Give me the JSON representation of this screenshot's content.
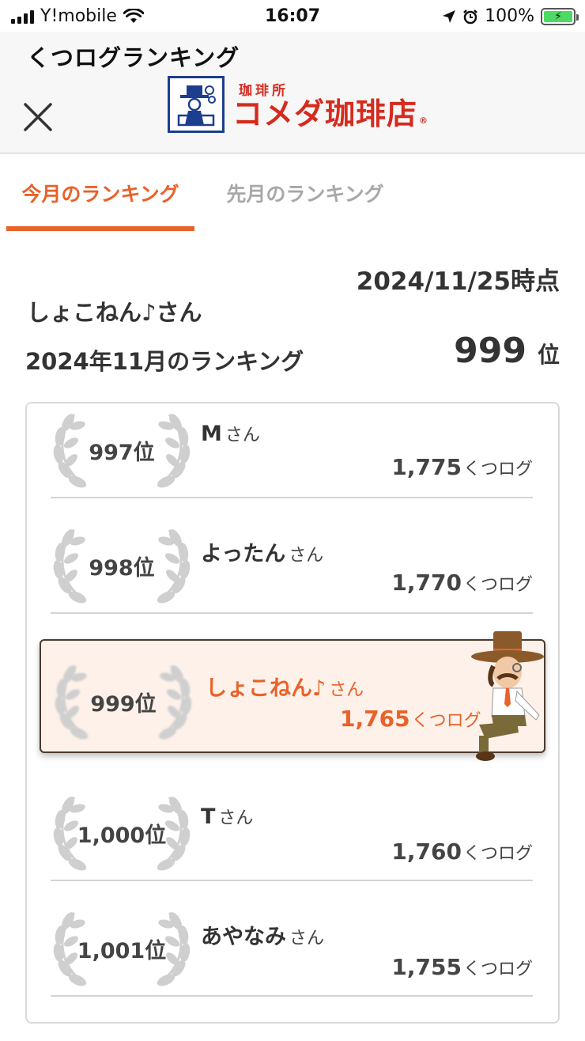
{
  "status_bar": {
    "carrier": "Y!mobile",
    "time": "16:07",
    "battery": "100%"
  },
  "header": {
    "title": "くつログランキング",
    "logo": {
      "small_text": "珈琲所",
      "main_text": "コメダ珈琲店",
      "mark": "®"
    }
  },
  "tabs": [
    {
      "label": "今月のランキング",
      "active": true
    },
    {
      "label": "先月のランキング",
      "active": false
    }
  ],
  "summary": {
    "as_of": "2024/11/25時点",
    "user_name": "しょこねん♪さん",
    "month_label": "2024年11月のランキング",
    "rank_number": "999",
    "rank_unit": "位"
  },
  "ranking": {
    "suffix": "さん",
    "unit": "くつログ",
    "rows": [
      {
        "rank": "997位",
        "name": "M",
        "score": "1,775"
      },
      {
        "rank": "998位",
        "name": "よったん",
        "score": "1,770"
      },
      {
        "rank": "999位",
        "name": "しょこねん♪",
        "score": "1,765"
      },
      {
        "rank": "1,000位",
        "name": "T",
        "score": "1,760"
      },
      {
        "rank": "1,001位",
        "name": "あやなみ",
        "score": "1,755"
      }
    ]
  },
  "colors": {
    "accent": "#e8622a",
    "highlight_bg": "#fdf1e9",
    "logo_red": "#d52b1e",
    "logo_blue": "#1d3d8f"
  }
}
